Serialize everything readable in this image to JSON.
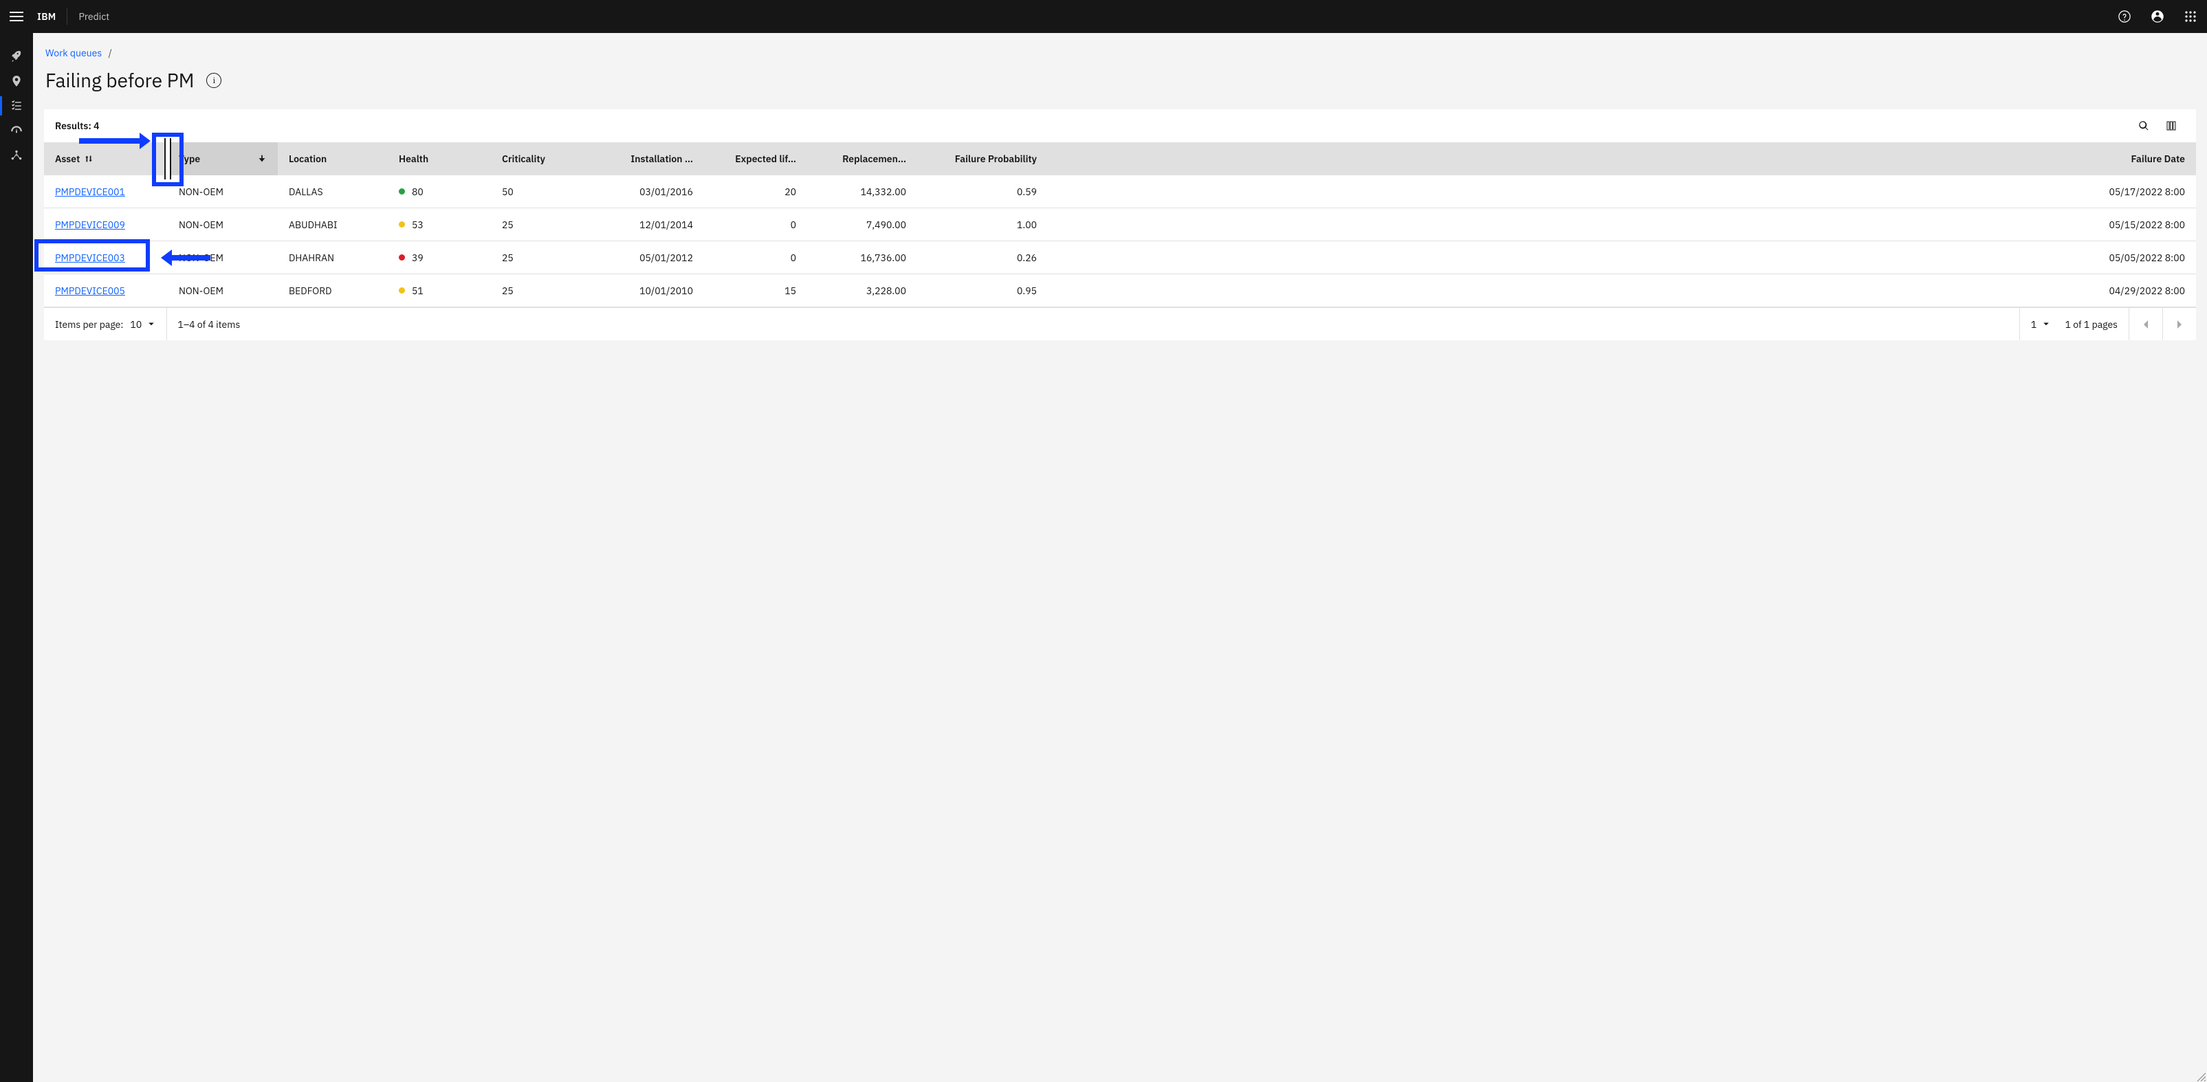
{
  "header": {
    "brand": "IBM",
    "app": "Predict"
  },
  "breadcrumb": {
    "link": "Work queues",
    "sep": "/"
  },
  "page": {
    "title": "Failing before PM"
  },
  "table": {
    "results_label": "Results: 4",
    "columns": {
      "asset": "Asset",
      "type": "Type",
      "location": "Location",
      "health": "Health",
      "criticality": "Criticality",
      "installation": "Installation …",
      "expected_life": "Expected lif…",
      "replacement": "Replacemen…",
      "failure_prob": "Failure Probability",
      "failure_date": "Failure Date"
    },
    "rows": [
      {
        "asset": "PMPDEVICE001",
        "type": "NON-OEM",
        "location": "DALLAS",
        "health_dot": "green",
        "health": "80",
        "criticality": "50",
        "installation": "03/01/2016",
        "expected_life": "20",
        "replacement": "14,332.00",
        "failure_prob": "0.59",
        "failure_date": "05/17/2022 8:00"
      },
      {
        "asset": "PMPDEVICE009",
        "type": "NON-OEM",
        "location": "ABUDHABI",
        "health_dot": "yellow",
        "health": "53",
        "criticality": "25",
        "installation": "12/01/2014",
        "expected_life": "0",
        "replacement": "7,490.00",
        "failure_prob": "1.00",
        "failure_date": "05/15/2022 8:00"
      },
      {
        "asset": "PMPDEVICE003",
        "type": "NON-OEM",
        "location": "DHAHRAN",
        "health_dot": "red",
        "health": "39",
        "criticality": "25",
        "installation": "05/01/2012",
        "expected_life": "0",
        "replacement": "16,736.00",
        "failure_prob": "0.26",
        "failure_date": "05/05/2022 8:00"
      },
      {
        "asset": "PMPDEVICE005",
        "type": "NON-OEM",
        "location": "BEDFORD",
        "health_dot": "yellow",
        "health": "51",
        "criticality": "25",
        "installation": "10/01/2010",
        "expected_life": "15",
        "replacement": "3,228.00",
        "failure_prob": "0.95",
        "failure_date": "04/29/2022 8:00"
      }
    ]
  },
  "pagination": {
    "items_per_page_label": "Items per page:",
    "items_per_page_value": "10",
    "range": "1–4 of 4 items",
    "page_value": "1",
    "pages_label": "1 of 1 pages"
  },
  "colors": {
    "link": "#0f62fe",
    "accent": "#0f3dff",
    "green": "#24a148",
    "yellow": "#f1c21b",
    "red": "#da1e28"
  }
}
